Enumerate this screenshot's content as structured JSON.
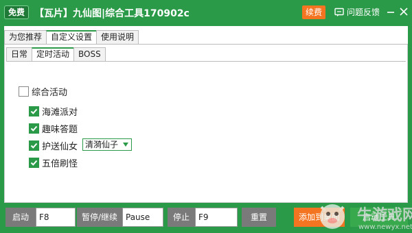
{
  "titlebar": {
    "free_badge": "免费",
    "title": "【瓦片】九仙图|综合工具170902c",
    "renew_label": "续费",
    "feedback_label": "问题反馈"
  },
  "tabs_main": [
    {
      "label": "为您推荐",
      "active": false
    },
    {
      "label": "自定义设置",
      "active": true
    },
    {
      "label": "使用说明",
      "active": false
    }
  ],
  "tabs_sub": [
    {
      "label": "日常",
      "active": false
    },
    {
      "label": "定时活动",
      "active": true
    },
    {
      "label": "BOSS",
      "active": false
    }
  ],
  "activities": {
    "group_label": "综合活动",
    "group_checked": false,
    "items": [
      {
        "label": "海滩派对",
        "checked": true
      },
      {
        "label": "趣味答题",
        "checked": true
      },
      {
        "label": "护送仙女",
        "checked": true
      },
      {
        "label": "五倍刷怪",
        "checked": true
      }
    ],
    "escort_select": "清漪仙子"
  },
  "bottom": {
    "start_label": "启动",
    "start_key": "F8",
    "pause_label": "暂停/继续",
    "pause_key": "Pause",
    "stop_label": "停止",
    "stop_key": "F9",
    "reset_label": "重置",
    "add_desktop_label": "添加到桌面",
    "launch_label": "启动工具"
  },
  "watermark": {
    "text": "牛游戏网",
    "url": "www.newyx.net"
  },
  "colors": {
    "brand_green": "#2b9a48",
    "accent_orange": "#f47521",
    "button_gray": "#7a7a7a"
  }
}
